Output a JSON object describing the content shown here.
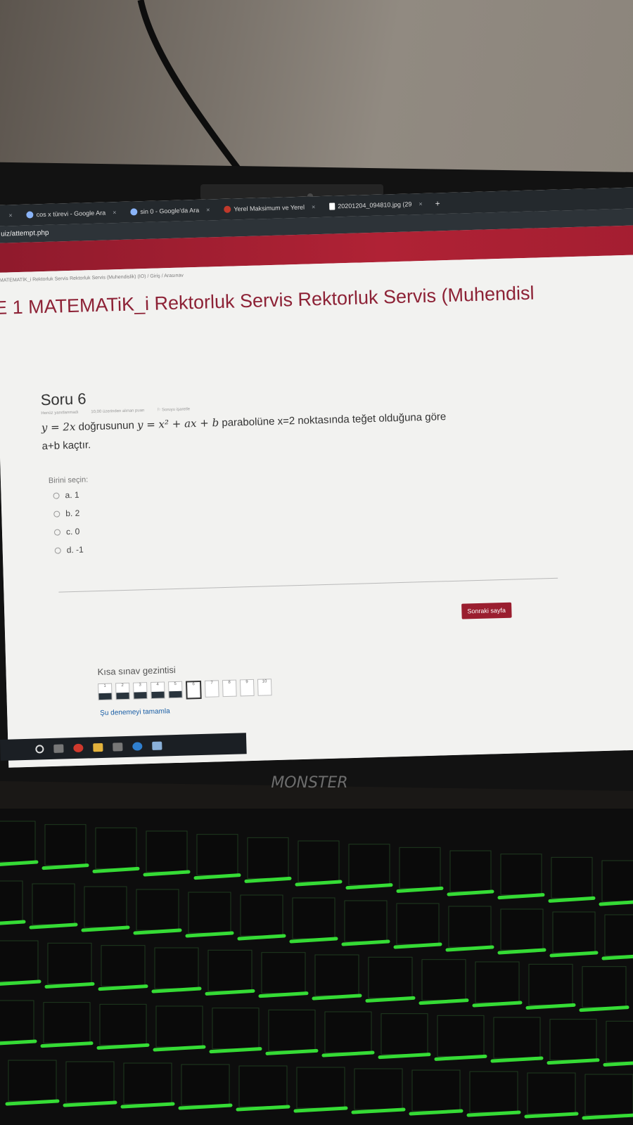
{
  "browser": {
    "tabs": [
      {
        "label": "cos x türevi - Google Ara"
      },
      {
        "label": "sin 0 - Google'da Ara"
      },
      {
        "label": "Yerel Maksimum ve Yerel"
      },
      {
        "label": "20201204_094810.jpg (29"
      }
    ],
    "new_tab": "+",
    "url": "uiz/attempt.php"
  },
  "page": {
    "breadcrumb": "MATEMATİK_i Rektorluk Servis Rektorluk Servis (Muhendislik) (IO) / Giriş / Arasınav",
    "course_title": "E 1 MATEMATiK_i Rektorluk Servis Rektorluk Servis (Muhendisl",
    "question": {
      "number": "Soru 6",
      "status": "Henüz yanıtlanmadı",
      "points": "10,00 üzerinden alınan puan",
      "flag": "Soruyu işaretle",
      "text_line1_math1": "y = 2x",
      "text_line1_mid": " doğrusunun ",
      "text_line1_math2": "y = x² + ax + b",
      "text_line1_end": " parabolüne x=2 noktasında teğet olduğuna göre",
      "text_line2": "a+b kaçtır.",
      "choose_label": "Birini seçin:",
      "options": [
        "a. 1",
        "b. 2",
        "c. 0",
        "d. -1"
      ]
    },
    "next_button": "Sonraki sayfa",
    "nav": {
      "title": "Kısa sınav gezintisi",
      "boxes": [
        "1",
        "2",
        "3",
        "4",
        "5",
        "6",
        "7",
        "8",
        "9",
        "10"
      ],
      "finish_link": "Şu denemeyi tamamla"
    }
  },
  "laptop": {
    "brand": "MONSTER"
  },
  "colors": {
    "accent": "#9a1e2f",
    "title": "#8d2236",
    "keyboard_glow": "#3cff3c"
  }
}
